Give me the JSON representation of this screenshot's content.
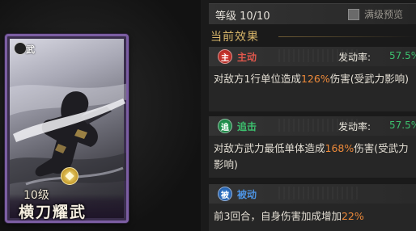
{
  "card": {
    "type_label": "武",
    "level_label": "10级",
    "name": "横刀耀武",
    "frame_color": "#7c5ea3"
  },
  "header": {
    "level_text": "等级 10/10",
    "max_preview_label": "满级预览",
    "max_preview_checked": false
  },
  "section_title": "当前效果",
  "skills": [
    {
      "icon_glyph": "主",
      "icon_color": "#c8302a",
      "type_label": "主动",
      "trigger_label": "发动率:",
      "trigger_value": "57.5%",
      "desc_before": "对敌方1行单位造成",
      "desc_highlight": "126%",
      "desc_after": "伤害(受武力影响)"
    },
    {
      "icon_glyph": "追",
      "icon_color": "#1f9150",
      "type_label": "追击",
      "trigger_label": "发动率:",
      "trigger_value": "57.5%",
      "desc_before": "对敌方武力最低单体造成",
      "desc_highlight": "168%",
      "desc_after": "伤害(受武力影响)"
    },
    {
      "icon_glyph": "被",
      "icon_color": "#2a6ec2",
      "type_label": "被动",
      "desc_before": "前3回合，自身伤害加成增加",
      "desc_highlight": "22%",
      "desc_after": ""
    }
  ]
}
